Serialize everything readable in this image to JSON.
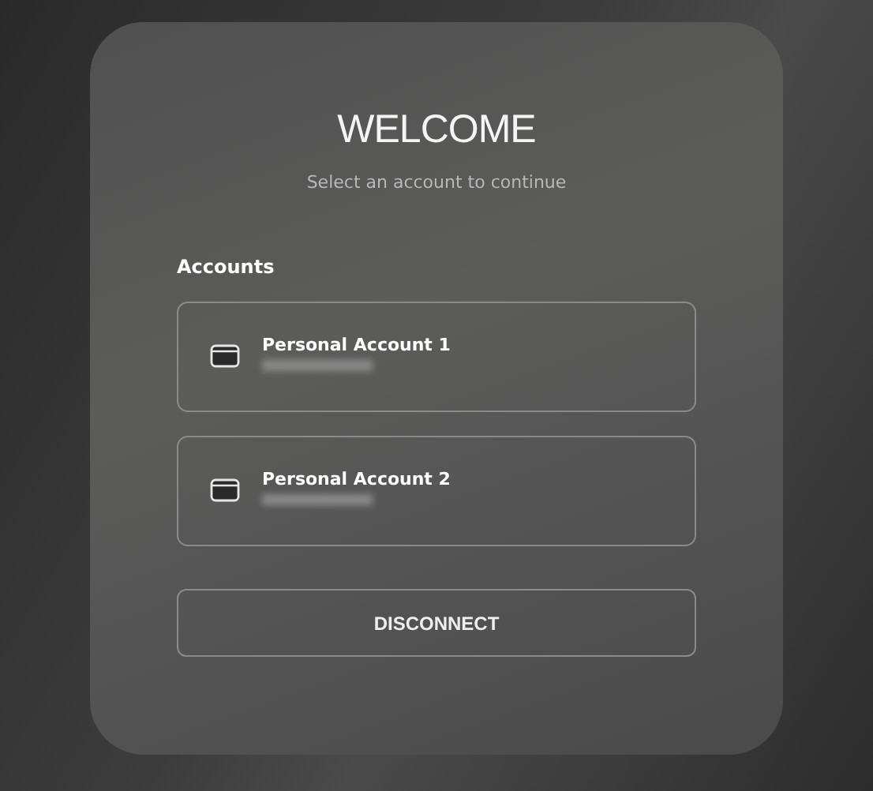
{
  "title": "WELCOME",
  "subtitle": "Select an account to continue",
  "section_label": "Accounts",
  "accounts": [
    {
      "name": "Personal Account 1"
    },
    {
      "name": "Personal Account 2"
    }
  ],
  "disconnect_button": "DISCONNECT"
}
